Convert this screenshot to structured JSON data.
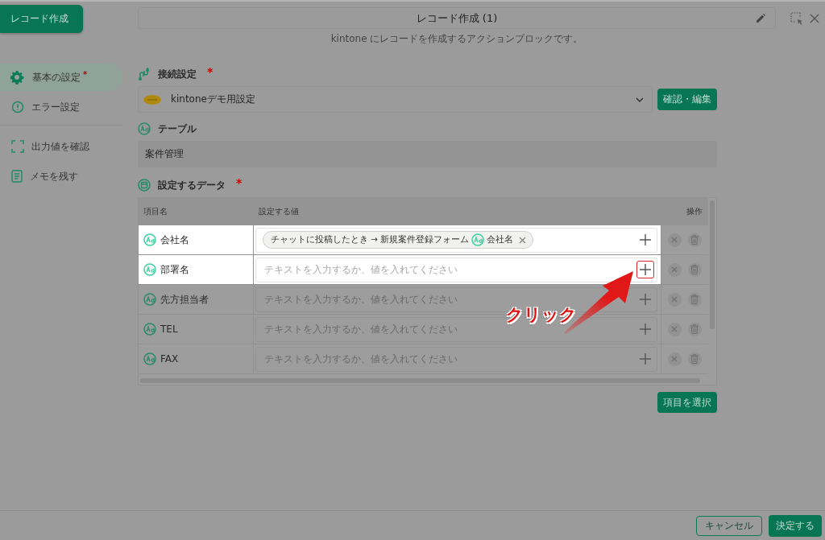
{
  "block_button": "レコード作成",
  "required_mark": "*",
  "sidebar": {
    "items": [
      {
        "kind": "gear",
        "label": "基本の設定",
        "required": true,
        "selected": true
      },
      {
        "kind": "alert",
        "label": "エラー設定",
        "required": false,
        "selected": false
      },
      {
        "kind": "divider"
      },
      {
        "kind": "frame",
        "label": "出力値を確認",
        "required": false,
        "selected": false
      },
      {
        "kind": "memo",
        "label": "メモを残す",
        "required": false,
        "selected": false
      }
    ]
  },
  "title_field": {
    "value": "レコード作成 (1)"
  },
  "subtitle": "kintone にレコードを作成するアクションブロックです。",
  "connection": {
    "heading": "接続設定",
    "required": true,
    "value": "kintoneデモ用設定",
    "button": "確認・編集"
  },
  "table_section": {
    "heading": "テーブル",
    "value": "案件管理"
  },
  "data_section": {
    "heading": "設定するデータ",
    "required": true,
    "columns": [
      "項目名",
      "設定する値",
      "操作"
    ],
    "rows": [
      {
        "name": "会社名",
        "highlighted": true,
        "outlined": false,
        "chips": [
          {
            "source": "チャットに投稿したとき → 新規案件登録フォーム",
            "field": "会社名"
          }
        ]
      },
      {
        "name": "部署名",
        "highlighted": true,
        "outlined": true,
        "placeholder": "テキストを入力するか、値を入れてください"
      },
      {
        "name": "先方担当者",
        "highlighted": false,
        "outlined": false,
        "placeholder": "テキストを入力するか、値を入れてください"
      },
      {
        "name": "TEL",
        "highlighted": false,
        "outlined": false,
        "placeholder": "テキストを入力するか、値を入れてください"
      },
      {
        "name": "FAX",
        "highlighted": false,
        "outlined": false,
        "placeholder": "テキストを入力するか、値を入れてください"
      }
    ],
    "select_button": "項目を選択"
  },
  "annotation": {
    "text": "クリック"
  },
  "footer": {
    "cancel": "キャンセル",
    "submit": "決定する"
  }
}
